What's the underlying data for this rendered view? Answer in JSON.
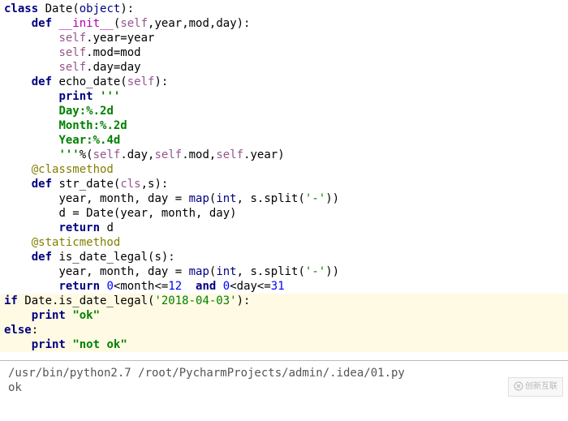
{
  "code": {
    "line1": {
      "kw_class": "class",
      "name": "Date",
      "obj": "object",
      "tail": "):"
    },
    "line2": {
      "indent": "    ",
      "kw_def": "def",
      "name": "__init__",
      "lp": "(",
      "self": "self",
      "params": ",year,mod,day):"
    },
    "line3": {
      "indent": "        ",
      "self": "self",
      "tail": ".year=year"
    },
    "line4": {
      "indent": "        ",
      "self": "self",
      "tail": ".mod=mod"
    },
    "line5": {
      "indent": "        ",
      "self": "self",
      "tail": ".day=day"
    },
    "line6": {
      "indent": "    ",
      "kw_def": "def",
      "name": " echo_date(",
      "self": "self",
      "tail": "):"
    },
    "line7": {
      "indent": "        ",
      "kw_print": "print",
      "str": " '''"
    },
    "line8": {
      "indent": "        ",
      "str": "Day:%.2d"
    },
    "line9": {
      "indent": "        ",
      "str": "Month:%.2d"
    },
    "line10": {
      "indent": "        ",
      "str": "Year:%.4d"
    },
    "line11": {
      "indent": "        ",
      "str": "'''",
      "pct": "%(",
      "self1": "self",
      "d1": ".day,",
      "self2": "self",
      "d2": ".mod,",
      "self3": "self",
      "d3": ".year)"
    },
    "line12": {
      "indent": "    ",
      "dec": "@classmethod"
    },
    "line13": {
      "indent": "    ",
      "kw_def": "def",
      "name": " str_date(",
      "cls": "cls",
      "tail": ",s):"
    },
    "line14": {
      "indent": "        ",
      "assign": "year, month, day = ",
      "map": "map",
      "lp": "(",
      "int": "int",
      "mid": ", s.split(",
      "dash": "'-'",
      "tail": "))"
    },
    "line15": {
      "indent": "        ",
      "text": "d = Date(year, month, day)"
    },
    "line16": {
      "indent": "        ",
      "kw_return": "return",
      "tail": " d"
    },
    "line17": {
      "indent": "    ",
      "dec": "@staticmethod"
    },
    "line18": {
      "indent": "    ",
      "kw_def": "def",
      "name": " is_date_legal(s):"
    },
    "line19": {
      "indent": "        ",
      "assign": "year, month, day = ",
      "map": "map",
      "lp": "(",
      "int": "int",
      "mid": ", s.split(",
      "dash": "'-'",
      "tail": "))"
    },
    "line20": {
      "indent": "        ",
      "kw_return": "return",
      "sp1": " ",
      "n0a": "0",
      "cmp1": "<month<=",
      "n12": "12",
      "sp2": "  ",
      "kw_and": "and",
      "sp3": " ",
      "n0b": "0",
      "cmp2": "<day<=",
      "n31": "31"
    },
    "line21": {
      "kw_if": "if",
      "text": " Date.is_date_legal(",
      "str": "'2018-04-03'",
      "tail": "):"
    },
    "line22": {
      "indent": "    ",
      "kw_print": "print",
      "sp": " ",
      "str": "\"ok\""
    },
    "line23": {
      "kw_else": "else",
      "tail": ":"
    },
    "line24": {
      "indent": "    ",
      "kw_print": "print",
      "sp": " ",
      "str": "\"not ok\""
    }
  },
  "console": {
    "path": "/usr/bin/python2.7 /root/PycharmProjects/admin/.idea/01.py",
    "output": "ok"
  },
  "watermark": "创新互联"
}
